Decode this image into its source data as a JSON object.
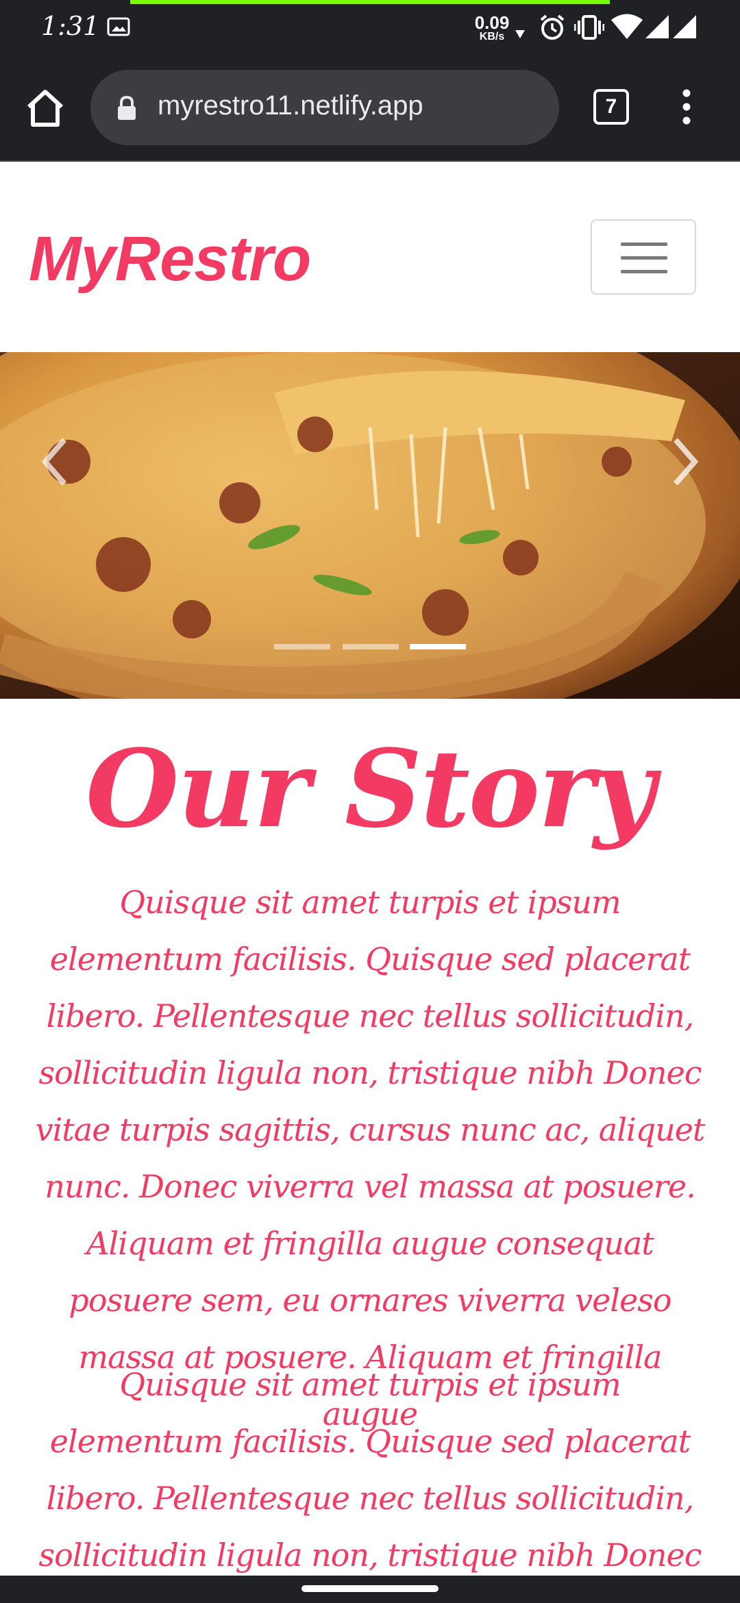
{
  "status_bar": {
    "time": "1:31",
    "net_speed_value": "0.09",
    "net_speed_unit": "KB/s",
    "icons": [
      "image-notification-icon",
      "alarm-icon",
      "vibrate-icon",
      "wifi-icon",
      "signal-icon"
    ]
  },
  "browser": {
    "url": "myrestro11.netlify.app",
    "tab_count": "7",
    "accent_color": "#76ff03"
  },
  "site": {
    "brand": "MyRestro",
    "brand_color": "#f33a62"
  },
  "carousel": {
    "slide_count": 3,
    "active_index": 2
  },
  "story": {
    "title": "Our Story",
    "paragraphs": [
      "Quisque sit amet turpis et ipsum elementum facilisis. Quisque sed placerat libero. Pellentesque nec tellus sollicitudin, sollicitudin ligula non, tristique nibh Donec vitae turpis sagittis, cursus nunc ac, aliquet nunc. Donec viverra vel massa at posuere. Aliquam et fringilla augue consequat posuere sem, eu ornares viverra veleso massa at posuere. Aliquam et fringilla augue",
      "Quisque sit amet turpis et ipsum elementum facilisis. Quisque sed placerat libero. Pellentesque nec tellus sollicitudin, sollicitudin ligula non, tristique nibh Donec vitae turpis sagittis, cursus nunc ac, aliquet"
    ]
  }
}
